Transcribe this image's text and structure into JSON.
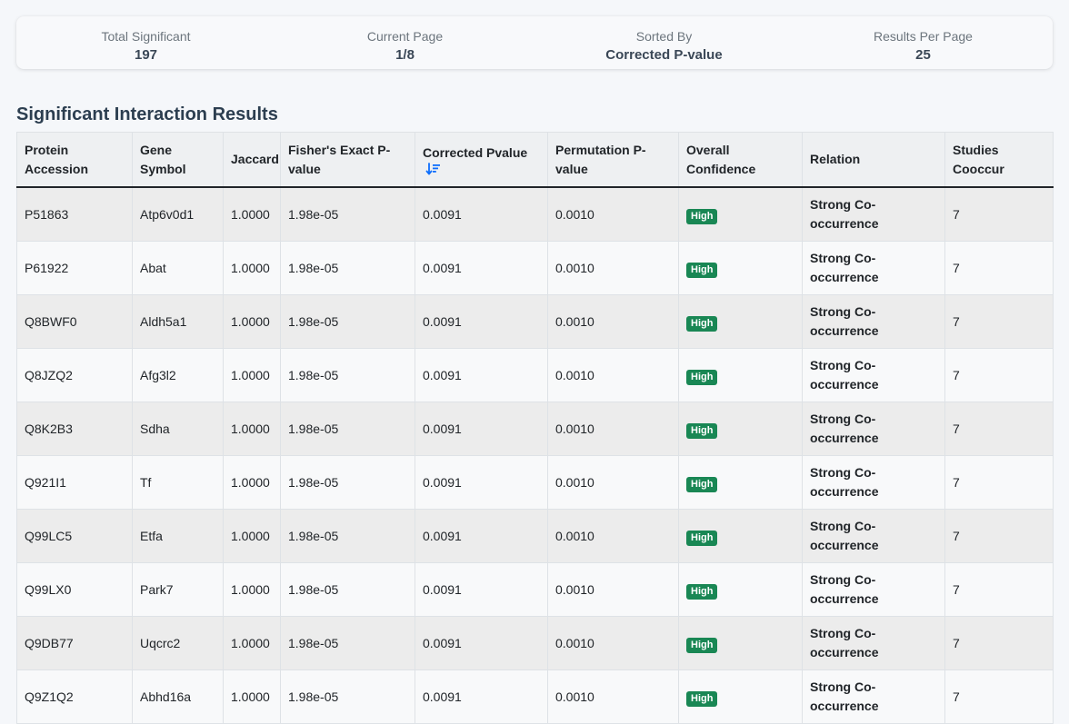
{
  "summary": {
    "total_label": "Total Significant",
    "total_value": "197",
    "page_label": "Current Page",
    "page_value": "1/8",
    "sort_label": "Sorted By",
    "sort_value": "Corrected P-value",
    "per_page_label": "Results Per Page",
    "per_page_value": "25"
  },
  "section_title": "Significant Interaction Results",
  "sort_icon": "sort-amount-down-icon",
  "colors": {
    "badge_high": "#198754",
    "relation_strong": "#28a745"
  },
  "table": {
    "headers": [
      "Protein Accession",
      "Gene Symbol",
      "Jaccard",
      "Fisher's Exact P-value",
      "Corrected Pvalue",
      "Permutation P-value",
      "Overall Confidence",
      "Relation",
      "Studies Cooccur"
    ],
    "rows": [
      {
        "accession": "P51863",
        "gene": "Atp6v0d1",
        "jaccard": "1.0000",
        "fisher": "1.98e-05",
        "corrected": "0.0091",
        "permutation": "0.0010",
        "confidence": "High",
        "relation": "Strong Co-occurrence",
        "studies": "7"
      },
      {
        "accession": "P61922",
        "gene": "Abat",
        "jaccard": "1.0000",
        "fisher": "1.98e-05",
        "corrected": "0.0091",
        "permutation": "0.0010",
        "confidence": "High",
        "relation": "Strong Co-occurrence",
        "studies": "7"
      },
      {
        "accession": "Q8BWF0",
        "gene": "Aldh5a1",
        "jaccard": "1.0000",
        "fisher": "1.98e-05",
        "corrected": "0.0091",
        "permutation": "0.0010",
        "confidence": "High",
        "relation": "Strong Co-occurrence",
        "studies": "7"
      },
      {
        "accession": "Q8JZQ2",
        "gene": "Afg3l2",
        "jaccard": "1.0000",
        "fisher": "1.98e-05",
        "corrected": "0.0091",
        "permutation": "0.0010",
        "confidence": "High",
        "relation": "Strong Co-occurrence",
        "studies": "7"
      },
      {
        "accession": "Q8K2B3",
        "gene": "Sdha",
        "jaccard": "1.0000",
        "fisher": "1.98e-05",
        "corrected": "0.0091",
        "permutation": "0.0010",
        "confidence": "High",
        "relation": "Strong Co-occurrence",
        "studies": "7"
      },
      {
        "accession": "Q921I1",
        "gene": "Tf",
        "jaccard": "1.0000",
        "fisher": "1.98e-05",
        "corrected": "0.0091",
        "permutation": "0.0010",
        "confidence": "High",
        "relation": "Strong Co-occurrence",
        "studies": "7"
      },
      {
        "accession": "Q99LC5",
        "gene": "Etfa",
        "jaccard": "1.0000",
        "fisher": "1.98e-05",
        "corrected": "0.0091",
        "permutation": "0.0010",
        "confidence": "High",
        "relation": "Strong Co-occurrence",
        "studies": "7"
      },
      {
        "accession": "Q99LX0",
        "gene": "Park7",
        "jaccard": "1.0000",
        "fisher": "1.98e-05",
        "corrected": "0.0091",
        "permutation": "0.0010",
        "confidence": "High",
        "relation": "Strong Co-occurrence",
        "studies": "7"
      },
      {
        "accession": "Q9DB77",
        "gene": "Uqcrc2",
        "jaccard": "1.0000",
        "fisher": "1.98e-05",
        "corrected": "0.0091",
        "permutation": "0.0010",
        "confidence": "High",
        "relation": "Strong Co-occurrence",
        "studies": "7"
      },
      {
        "accession": "Q9Z1Q2",
        "gene": "Abhd16a",
        "jaccard": "1.0000",
        "fisher": "1.98e-05",
        "corrected": "0.0091",
        "permutation": "0.0010",
        "confidence": "High",
        "relation": "Strong Co-occurrence",
        "studies": "7"
      }
    ]
  }
}
